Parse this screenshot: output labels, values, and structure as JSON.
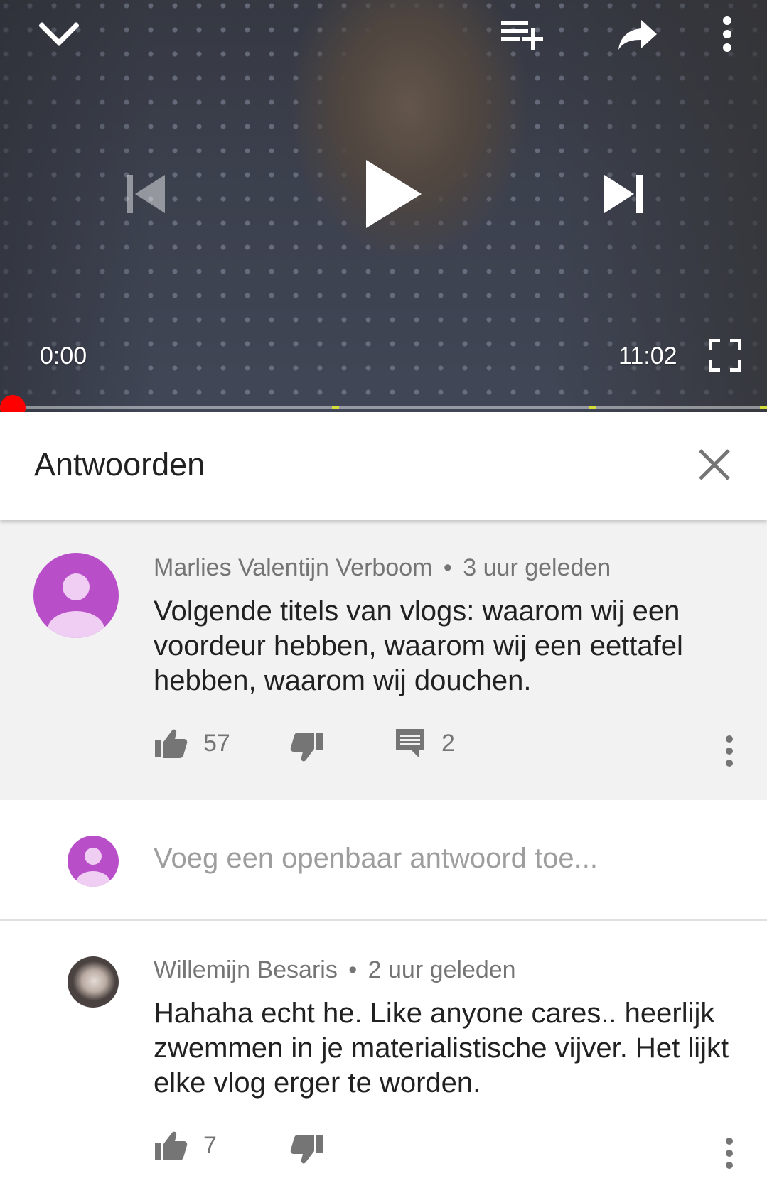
{
  "player": {
    "current_time": "0:00",
    "duration": "11:02",
    "progress_fraction": 0.0,
    "chapter_marker_fractions": [
      0.433,
      0.768,
      0.995
    ],
    "icons": {
      "minimize": "chevron-down-icon",
      "add_to_playlist": "playlist-add-icon",
      "share": "share-icon",
      "more": "more-vert-icon",
      "previous": "skip-previous-icon",
      "play": "play-icon",
      "next": "skip-next-icon",
      "fullscreen": "fullscreen-icon"
    }
  },
  "replies_panel": {
    "title": "Antwoorden"
  },
  "parent_comment": {
    "author": "Marlies Valentijn Verboom",
    "separator": "•",
    "time": "3 uur geleden",
    "text": "Volgende titels van vlogs: waarom wij een voordeur hebben, waarom wij een eettafel hebben, waarom wij douchen.",
    "likes": "57",
    "replies": "2",
    "avatar_color": "#b84fc9"
  },
  "reply_box": {
    "placeholder": "Voeg een openbaar antwoord toe...",
    "avatar_color": "#b84fc9"
  },
  "replies": [
    {
      "author": "Willemijn Besaris",
      "separator": "•",
      "time": "2 uur geleden",
      "text": "Hahaha echt he. Like anyone cares.. heerlijk zwemmen in je materialistische vijver. Het lijkt elke vlog erger te worden.",
      "likes": "7"
    }
  ],
  "colors": {
    "accent_red": "#ff0000",
    "marker_yellow": "#d4dd3a",
    "secondary_text": "#757575",
    "panel_background": "#f2f2f2"
  }
}
